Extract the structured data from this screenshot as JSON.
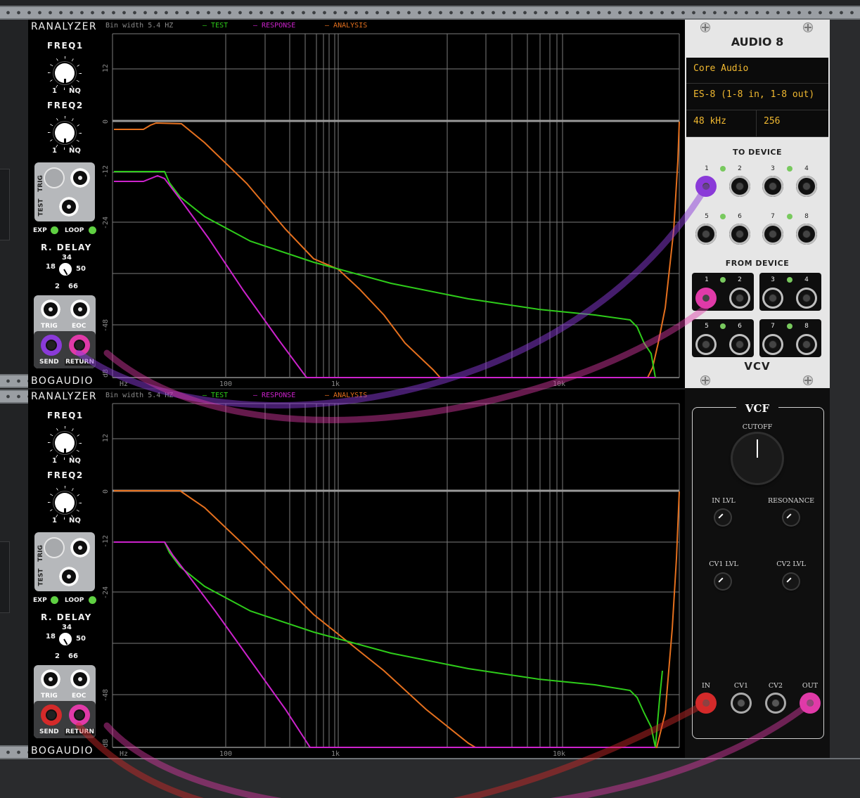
{
  "colors": {
    "test": "#2ecc1a",
    "response": "#cc22cc",
    "analysis": "#e5701e",
    "cable_purple": "#8a3ad8",
    "cable_pink": "#e03aa8",
    "cable_red": "#d42a2a"
  },
  "analyzer_top": {
    "title": "RANALYZER",
    "brand": "BOGAUDIO",
    "bin_width": "Bin width 5.4 HZ",
    "legend": {
      "test": "TEST",
      "response": "RESPONSE",
      "analysis": "ANALYSIS"
    },
    "freq1_label": "FREQ1",
    "freq2_label": "FREQ2",
    "knob_min": "1",
    "knob_max": "NQ",
    "trig_label": "TRIG",
    "test_label": "TEST",
    "exp_label": "EXP",
    "loop_label": "LOOP",
    "delay_label": "R. DELAY",
    "delay_values": {
      "top": "34",
      "left": "18",
      "right": "50",
      "bl": "2",
      "br": "66"
    },
    "trig_jack": "TRIG",
    "eoc_jack": "EOC",
    "send": "SEND",
    "return": "RETURN",
    "y_ticks": [
      "12",
      "0",
      "-12",
      "-24",
      "-48",
      "dB"
    ],
    "x_ticks": [
      "Hz",
      "100",
      "1k",
      "10k"
    ]
  },
  "analyzer_bottom": {
    "title": "RANALYZER",
    "brand": "BOGAUDIO",
    "bin_width": "Bin width 5.4 HZ",
    "legend": {
      "test": "TEST",
      "response": "RESPONSE",
      "analysis": "ANALYSIS"
    },
    "freq1_label": "FREQ1",
    "freq2_label": "FREQ2",
    "knob_min": "1",
    "knob_max": "NQ",
    "trig_label": "TRIG",
    "test_label": "TEST",
    "exp_label": "EXP",
    "loop_label": "LOOP",
    "delay_label": "R. DELAY",
    "delay_values": {
      "top": "34",
      "left": "18",
      "right": "50",
      "bl": "2",
      "br": "66"
    },
    "trig_jack": "TRIG",
    "eoc_jack": "EOC",
    "send": "SEND",
    "return": "RETURN",
    "y_ticks": [
      "12",
      "0",
      "-12",
      "-24",
      "-48",
      "dB"
    ],
    "x_ticks": [
      "Hz",
      "100",
      "1k",
      "10k"
    ]
  },
  "audio8": {
    "title": "AUDIO 8",
    "driver": "Core Audio",
    "device": "ES-8 (1-8 in, 1-8 out)",
    "sample_rate": "48 kHz",
    "block_size": "256",
    "to_device": "TO DEVICE",
    "from_device": "FROM DEVICE",
    "port_numbers": [
      "1",
      "2",
      "3",
      "4",
      "5",
      "6",
      "7",
      "8"
    ],
    "brand": "VCV"
  },
  "vcf": {
    "title": "VCF",
    "cutoff": "CUTOFF",
    "in_lvl": "IN LVL",
    "resonance": "RESONANCE",
    "cv1_lvl": "CV1 LVL",
    "cv2_lvl": "CV2 LVL",
    "ports": {
      "in": "IN",
      "cv1": "CV1",
      "cv2": "CV2",
      "out": "OUT"
    }
  }
}
